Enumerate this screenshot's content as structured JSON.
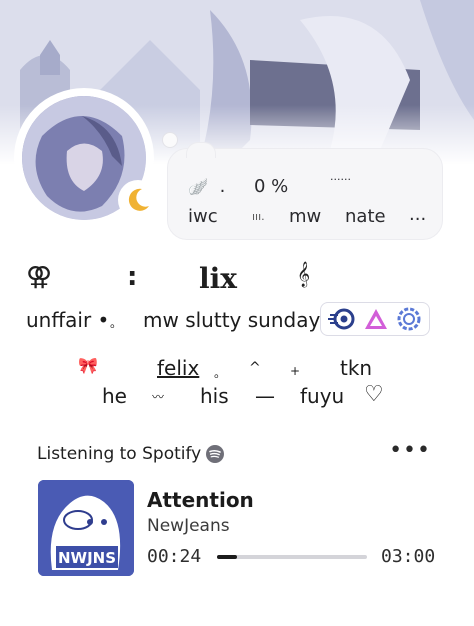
{
  "status": {
    "row1": {
      "emoji": "🪽",
      "dot": ".",
      "percent": "0 %",
      "dots": "......"
    },
    "row2": {
      "a": "iwc",
      "bars": "ııı.",
      "b": "mw",
      "c": "nate",
      "more": "..."
    }
  },
  "name_row": {
    "gender_symbol": "⚢",
    "colon": ":",
    "name": "lix",
    "clef": "𝄞"
  },
  "line1": {
    "a": "unffair •",
    "circle": "。",
    "b": "mw slutty sunday"
  },
  "line2": {
    "bow": "🎀",
    "felix": "felix",
    "small_circle": "。",
    "caret": "^",
    "plus": "+",
    "tkn": "tkn"
  },
  "line3": {
    "he": "he",
    "mustache": "〰",
    "his": "his",
    "dash": "—",
    "fuyu": "fuyu",
    "heart": "♡"
  },
  "spotify": {
    "label": "Listening to Spotify",
    "more": "•••",
    "song": "Attention",
    "artist": "NewJeans",
    "elapsed": "00:24",
    "total": "03:00",
    "progress": 0.133,
    "album_text": "NWJNS"
  },
  "colors": {
    "accent": "#1c1c1c",
    "track": "#d4d4d9",
    "album": "#3d4fa8"
  }
}
